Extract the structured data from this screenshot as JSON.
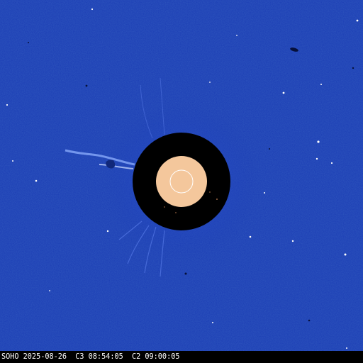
{
  "image": {
    "caption": "SOHO 2025-08-26  C3 08:54:05  C2 09:00:05",
    "colors": {
      "background": "#1a3bb4",
      "occulter": "#000000",
      "sun_disk": "#f4c79c",
      "sun_outline": "#ffffff",
      "caption_text": "#ffffff"
    }
  }
}
